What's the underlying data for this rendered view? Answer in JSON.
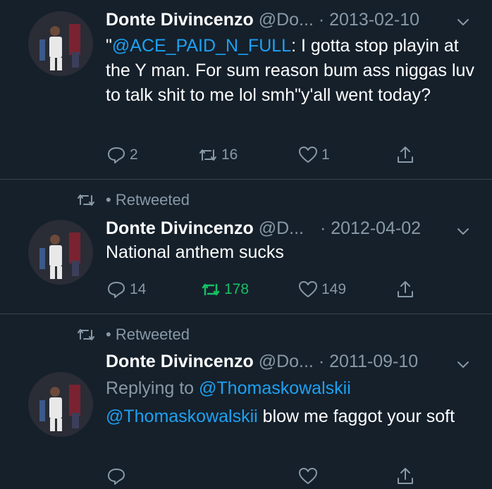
{
  "tweets": [
    {
      "retweet_label": "",
      "author_name": "Donte Divincenzo",
      "handle": "@Do...",
      "date": "· 2013-02-10",
      "body_parts": [
        {
          "text": "\"",
          "link": false
        },
        {
          "text": "@ACE_PAID_N_FULL",
          "link": true
        },
        {
          "text": ": I gotta stop playin at the Y man. For sum reason bum ass niggas luv to talk shit to me lol smh\"y'all went today?",
          "link": false
        }
      ],
      "reply_count": "2",
      "retweet_count": "16",
      "like_count": "1"
    },
    {
      "retweet_label": "• Retweeted",
      "author_name": "Donte Divincenzo",
      "handle": "@D...",
      "date": "· 2012-04-02",
      "body_parts": [
        {
          "text": "National anthem sucks",
          "link": false
        }
      ],
      "reply_count": "14",
      "retweet_count": "178",
      "like_count": "149"
    },
    {
      "retweet_label": "• Retweeted",
      "author_name": "Donte Divincenzo",
      "handle": "@Do...",
      "date": "· 2011-09-10",
      "replying_prefix": "Replying to ",
      "replying_handle": "@Thomaskowalskii",
      "body_parts": [
        {
          "text": "@Thomaskowalskii",
          "link": true
        },
        {
          "text": " blow me faggot your soft",
          "link": false
        }
      ]
    }
  ],
  "colors": {
    "background": "#15202b",
    "link": "#1da1f2",
    "muted": "#8899a6",
    "retweet_active": "#17bf63",
    "divider": "#38444d"
  },
  "icons": [
    "reply-icon",
    "retweet-icon",
    "like-icon",
    "share-icon",
    "chevron-down-icon"
  ]
}
